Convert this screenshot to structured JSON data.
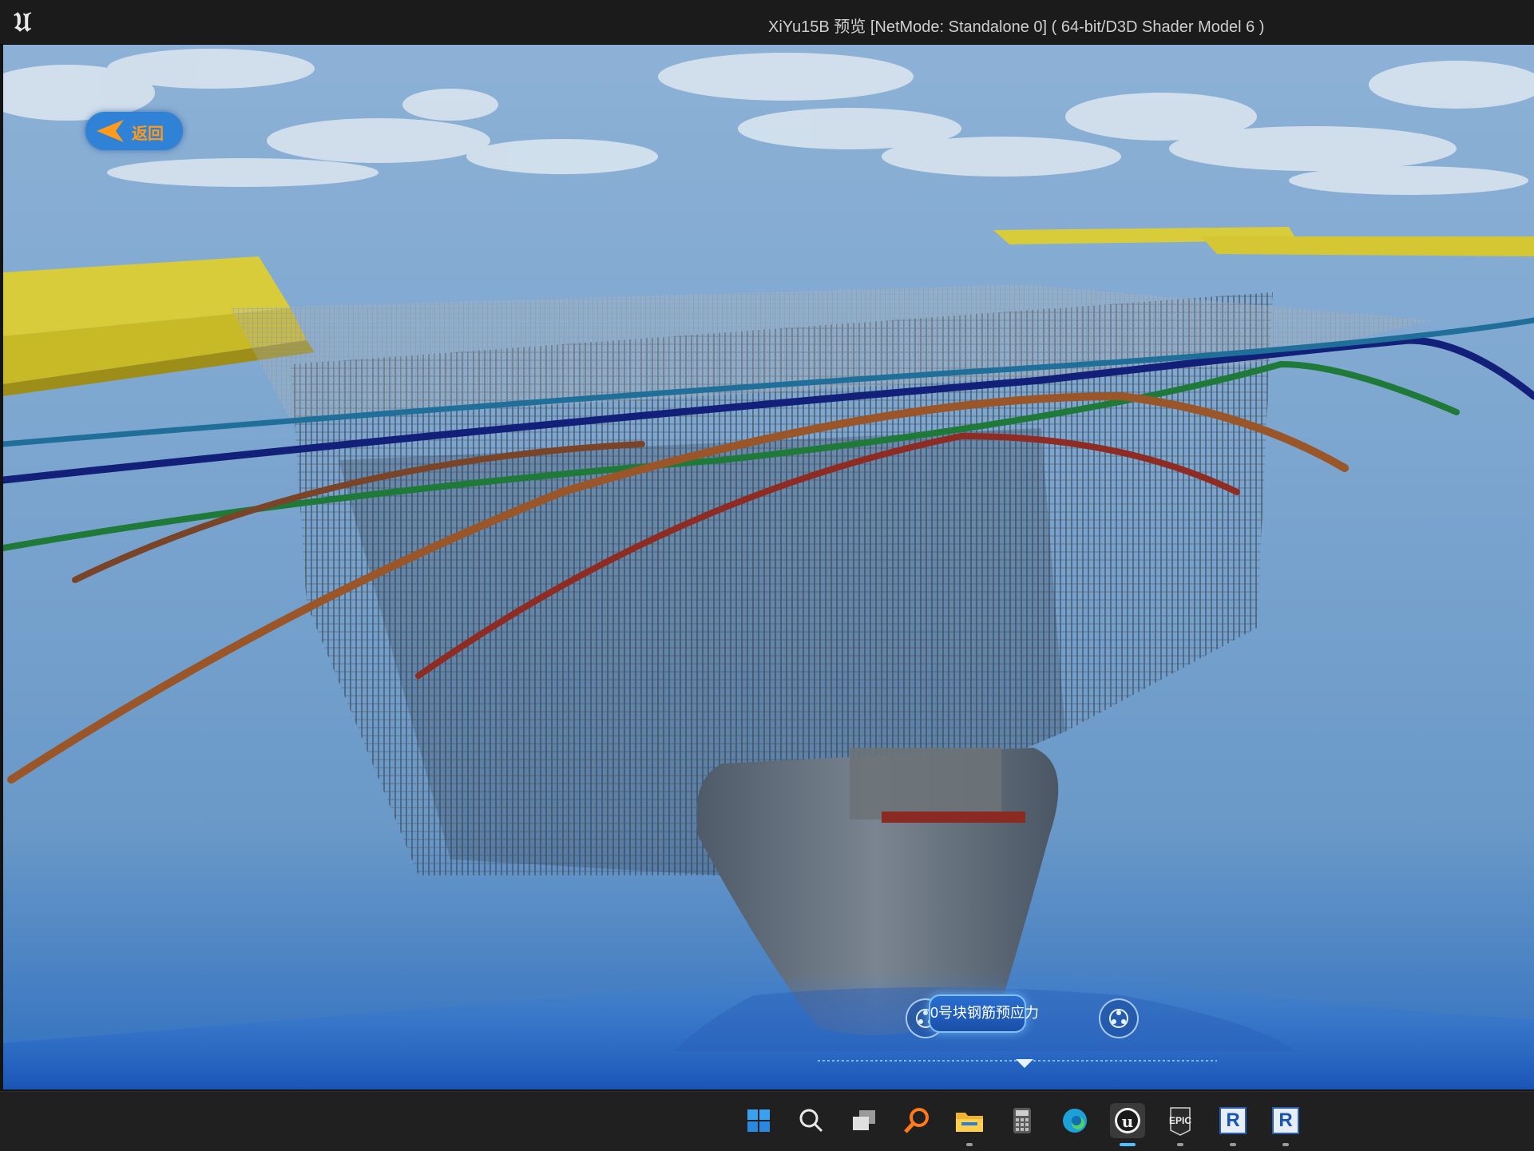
{
  "window": {
    "title": "XiYu15B 预览 [NetMode: Standalone 0]  ( 64-bit/D3D Shader Model 6 )",
    "logo_icon": "unreal-engine-logo"
  },
  "viewport": {
    "back_button": {
      "label": "返回",
      "icon": "arrow-left-icon"
    },
    "hud": {
      "center_label": "0号块钢筋预应力",
      "left_icon": "model-nodes-icon",
      "right_icon": "model-nodes-icon"
    }
  },
  "taskbar": {
    "items": [
      {
        "name": "start",
        "icon": "windows-start-icon"
      },
      {
        "name": "search",
        "icon": "search-icon"
      },
      {
        "name": "task-view",
        "icon": "task-view-icon"
      },
      {
        "name": "everything",
        "icon": "magnifier-orange-icon"
      },
      {
        "name": "file-explorer",
        "icon": "folder-icon"
      },
      {
        "name": "calculator",
        "icon": "calculator-icon"
      },
      {
        "name": "edge",
        "icon": "edge-icon"
      },
      {
        "name": "unreal-editor",
        "icon": "unreal-engine-icon",
        "active": true
      },
      {
        "name": "epic-games",
        "icon": "epic-games-icon",
        "text": "EPIC"
      },
      {
        "name": "revit-1",
        "icon": "revit-icon",
        "text": "R"
      },
      {
        "name": "revit-2",
        "icon": "revit-icon",
        "text": "R"
      }
    ]
  },
  "colors": {
    "hud_accent": "#2a6fd2",
    "back_button": "#2f82d6",
    "back_label": "#ff9a1a",
    "taskbar_bg": "#202020",
    "active_indicator": "#4cc2ff"
  }
}
